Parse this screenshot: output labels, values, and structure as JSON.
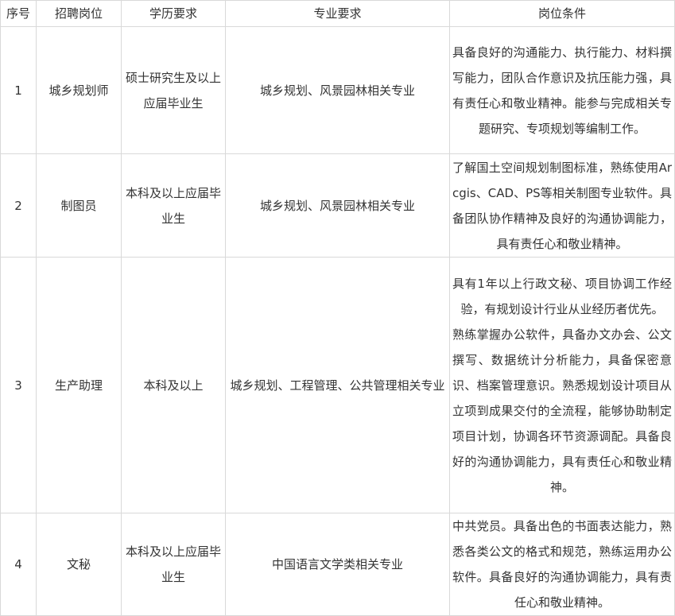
{
  "headers": [
    "序号",
    "招聘岗位",
    "学历要求",
    "专业要求",
    "岗位条件"
  ],
  "rows": [
    {
      "no": "1",
      "position": "城乡规划师",
      "education": "硕士研究生及以上应届毕业生",
      "major": "城乡规划、风景园林相关专业",
      "requirements": [
        "具备良好的沟通能力、执行能力、材料撰写能力，团队合作意识及抗压能力强，具有责任心和敬业精神。能参与完成相关专题研究、专项规划等编制工作。"
      ]
    },
    {
      "no": "2",
      "position": "制图员",
      "education": "本科及以上应届毕业生",
      "major": "城乡规划、风景园林相关专业",
      "requirements": [
        "了解国土空间规划制图标准，熟练使用Arcgis、CAD、PS等相关制图专业软件。具备团队协作精神及良好的沟通协调能力，具有责任心和敬业精神。"
      ]
    },
    {
      "no": "3",
      "position": "生产助理",
      "education": "本科及以上",
      "major": "城乡规划、工程管理、公共管理相关专业",
      "requirements": [
        "具有1年以上行政文秘、项目协调工作经验，有规划设计行业从业经历者优先。",
        "熟练掌握办公软件，具备办文办会、公文撰写、数据统计分析能力，具备保密意识、档案管理意识。熟悉规划设计项目从立项到成果交付的全流程，能够协助制定项目计划，协调各环节资源调配。具备良好的沟通协调能力，具有责任心和敬业精神。"
      ]
    },
    {
      "no": "4",
      "position": "文秘",
      "education": "本科及以上应届毕业生",
      "major": "中国语言文学类相关专业",
      "requirements": [
        "中共党员。具备出色的书面表达能力，熟悉各类公文的格式和规范，熟练运用办公软件。具备良好的沟通协调能力，具有责任心和敬业精神。"
      ]
    }
  ]
}
